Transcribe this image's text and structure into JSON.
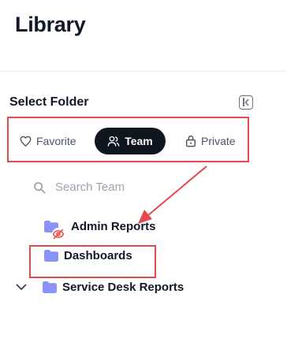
{
  "page": {
    "title": "Library"
  },
  "folder_panel": {
    "label": "Select Folder",
    "tabs": [
      {
        "label": "Favorite",
        "icon": "heart-icon"
      },
      {
        "label": "Team",
        "icon": "users-icon",
        "active": true
      },
      {
        "label": "Private",
        "icon": "lock-icon"
      }
    ],
    "search": {
      "placeholder": "Search Team"
    },
    "folders": [
      {
        "label": "Admin Reports",
        "icon": "folder-icon",
        "badge": "eye-off-icon"
      },
      {
        "label": "Dashboards",
        "icon": "folder-icon",
        "highlighted": true
      },
      {
        "label": "Service Desk Reports",
        "icon": "folder-icon",
        "expandable": true
      }
    ]
  },
  "colors": {
    "accent_dark": "#0f1620",
    "folder": "#8b93f8",
    "annotation": "#e5484d",
    "hidden_badge": "#ef4444"
  }
}
